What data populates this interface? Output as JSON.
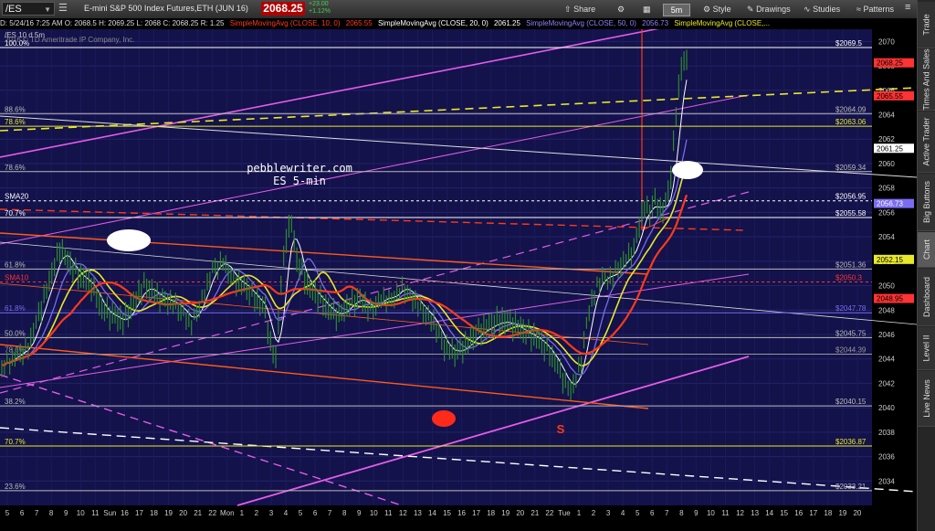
{
  "toolbar": {
    "symbol": "/ES",
    "description": "E-mini S&P 500 Index Futures,ETH (JUN 16)",
    "price": "2068.25",
    "change": "+23.00",
    "change_pct": "+1.12%",
    "share_label": "Share",
    "style_label": "Style",
    "aggregation": "5m",
    "drawings_label": "Drawings",
    "studies_label": "Studies",
    "patterns_label": "Patterns"
  },
  "study_row": {
    "info": "D: 5/24/16 7:25 AM  O: 2068.5  H: 2069.25  L: 2068  C: 2068.25  R: 1.25",
    "sma10": "SimpleMovingAvg (CLOSE, 10, 0)",
    "sma10_val": "2065.55",
    "sma20": "SimpleMovingAvg (CLOSE, 20, 0)",
    "sma20_val": "2061.25",
    "sma50": "SimpleMovingAvg (CLOSE, 50, 0)",
    "sma50_val": "2056.73",
    "sma200": "SimpleMovingAvg (CLOSE,..."
  },
  "chart_header": {
    "line1": "/ES 10 d 5m",
    "line2": "2016 © TD Ameritrade IP Company, Inc."
  },
  "sidebar_tabs": [
    "Trade",
    "Times And Sales",
    "Active Trader",
    "Big Buttons",
    "Chart",
    "Dashboard",
    "Level II",
    "Live News"
  ],
  "annotation": {
    "title": "pebblewriter.com",
    "subtitle": "ES 5-min",
    "s_label": "S"
  },
  "colors": {
    "background": "#13124a",
    "price_up": "#2e8b2e",
    "sma10": "#ff3a1a",
    "sma20": "#ffffff",
    "sma50": "#7a6cf0",
    "sma200": "#e8e82a",
    "channel": "#ff5a1a",
    "pink": "#e35ce8"
  },
  "chart_data": {
    "type": "line",
    "title": "/ES 10 d 5m",
    "ylim": [
      2032,
      2071
    ],
    "y_ticks": [
      2034,
      2036,
      2038,
      2040,
      2042,
      2044,
      2046,
      2048,
      2050,
      2052,
      2054,
      2056,
      2058,
      2060,
      2062,
      2064,
      2066,
      2068,
      2070
    ],
    "x_ticks": [
      "5",
      "6",
      "7",
      "8",
      "9",
      "10",
      "11",
      "Sun",
      "16",
      "17",
      "18",
      "19",
      "20",
      "21",
      "22",
      "Mon",
      "1",
      "2",
      "3",
      "4",
      "5",
      "6",
      "7",
      "8",
      "9",
      "10",
      "11",
      "12",
      "13",
      "14",
      "15",
      "16",
      "17",
      "18",
      "19",
      "20",
      "21",
      "22",
      "Tue",
      "1",
      "2",
      "3",
      "4",
      "5",
      "6",
      "7",
      "8",
      "9",
      "10",
      "11",
      "12",
      "13",
      "14",
      "15",
      "16",
      "17",
      "18",
      "19",
      "20"
    ],
    "price_path": [
      [
        0,
        2043.5
      ],
      [
        5,
        2045
      ],
      [
        8,
        2049
      ],
      [
        11,
        2053
      ],
      [
        14,
        2051
      ],
      [
        17,
        2050
      ],
      [
        19,
        2048
      ],
      [
        21,
        2047.5
      ],
      [
        23,
        2047
      ],
      [
        25,
        2048.5
      ],
      [
        27,
        2050
      ],
      [
        30,
        2049
      ],
      [
        33,
        2048.5
      ],
      [
        36,
        2047
      ],
      [
        38,
        2049
      ],
      [
        40,
        2051.5
      ],
      [
        42,
        2052
      ],
      [
        44,
        2050.5
      ],
      [
        46,
        2050
      ],
      [
        48,
        2049
      ],
      [
        50,
        2048
      ],
      [
        51,
        2045
      ],
      [
        52,
        2044
      ],
      [
        53,
        2050
      ],
      [
        54,
        2054
      ],
      [
        55,
        2055
      ],
      [
        56,
        2052
      ],
      [
        58,
        2050
      ],
      [
        60,
        2049
      ],
      [
        62,
        2048
      ],
      [
        64,
        2047.5
      ],
      [
        66,
        2048.5
      ],
      [
        68,
        2049
      ],
      [
        70,
        2048
      ],
      [
        72,
        2049
      ],
      [
        74,
        2049
      ],
      [
        76,
        2050
      ],
      [
        78,
        2049
      ],
      [
        80,
        2048
      ],
      [
        82,
        2047
      ],
      [
        84,
        2045
      ],
      [
        86,
        2044.5
      ],
      [
        88,
        2045
      ],
      [
        90,
        2046
      ],
      [
        92,
        2046.5
      ],
      [
        94,
        2047
      ],
      [
        96,
        2047
      ],
      [
        98,
        2046.5
      ],
      [
        100,
        2046
      ],
      [
        102,
        2045.5
      ],
      [
        104,
        2044.5
      ],
      [
        106,
        2043
      ],
      [
        107,
        2042
      ],
      [
        108,
        2041.5
      ],
      [
        109,
        2042.5
      ],
      [
        110,
        2044
      ],
      [
        111,
        2047
      ],
      [
        112,
        2049
      ],
      [
        113,
        2050
      ],
      [
        114,
        2051
      ],
      [
        115,
        2050.5
      ],
      [
        116,
        2051
      ],
      [
        118,
        2052
      ],
      [
        120,
        2053
      ],
      [
        121,
        2055
      ],
      [
        122,
        2056.5
      ],
      [
        123,
        2056
      ],
      [
        124,
        2057
      ],
      [
        125,
        2056
      ],
      [
        126,
        2056.5
      ],
      [
        127,
        2059
      ],
      [
        128,
        2064
      ],
      [
        129,
        2068
      ],
      [
        130,
        2068.25
      ]
    ],
    "moving_averages": [
      {
        "name": "SimpleMovingAvg (CLOSE, 10, 0)",
        "value": 2065.55
      },
      {
        "name": "SimpleMovingAvg (CLOSE, 20, 0)",
        "value": 2061.25
      },
      {
        "name": "SimpleMovingAvg (CLOSE, 50, 0)",
        "value": 2056.73
      },
      {
        "name": "SimpleMovingAvg (CLOSE,...",
        "value": 2052.15
      },
      {
        "name": "",
        "value": 2048.95
      }
    ],
    "price_tags": [
      {
        "value": 2068.25,
        "label": "2068.25",
        "color": "#ff3333",
        "text": "#000000"
      },
      {
        "value": 2065.55,
        "label": "2065.55",
        "color": "#ff3333",
        "text": "#000000"
      },
      {
        "value": 2061.25,
        "label": "2061.25",
        "color": "#ffffff",
        "text": "#000000"
      },
      {
        "value": 2056.73,
        "label": "2056.73",
        "color": "#7a6cf0",
        "text": "#ffffff"
      },
      {
        "value": 2052.15,
        "label": "2052.15",
        "color": "#e8e82a",
        "text": "#000000"
      },
      {
        "value": 2048.95,
        "label": "2048.95",
        "color": "#ff3333",
        "text": "#000000"
      }
    ],
    "horizontal_levels": [
      {
        "left": "100.0%",
        "right": "$2069.5",
        "value": 2069.5,
        "color": "#ffffff"
      },
      {
        "left": "88.6%",
        "right": "$2064.09",
        "value": 2064.09,
        "color": "#bbbbbb"
      },
      {
        "left": "78.6%",
        "right": "$2063.06",
        "value": 2063.06,
        "color": "#e8e82a"
      },
      {
        "left": "78.6%",
        "right": "$2059.34",
        "value": 2059.34,
        "color": "#bbbbbb"
      },
      {
        "left": "SMA20",
        "right": "$2056.95",
        "value": 2056.95,
        "color": "#ffffff"
      },
      {
        "left": "70.7%",
        "right": "$2055.58",
        "value": 2055.58,
        "color": "#ffffff"
      },
      {
        "left": "61.8%",
        "right": "$2051.36",
        "value": 2051.36,
        "color": "#bbbbbb"
      },
      {
        "left": "SMA10",
        "right": "$2050.3",
        "value": 2050.3,
        "color": "#ff3333"
      },
      {
        "left": "61.8%",
        "right": "$2047.78",
        "value": 2047.78,
        "color": "#7a6cf0"
      },
      {
        "left": "50.0%",
        "right": "$2045.75",
        "value": 2045.75,
        "color": "#bbbbbb"
      },
      {
        "left": "78.6%",
        "right": "$2044.39",
        "value": 2044.39,
        "color": "#999999"
      },
      {
        "left": "38.2%",
        "right": "$2040.15",
        "value": 2040.15,
        "color": "#bbbbbb"
      },
      {
        "left": "70.7%",
        "right": "$2036.87",
        "value": 2036.87,
        "color": "#e8e82a"
      },
      {
        "left": "23.6%",
        "right": "$2033.21",
        "value": 2033.21,
        "color": "#bbbbbb"
      }
    ]
  }
}
